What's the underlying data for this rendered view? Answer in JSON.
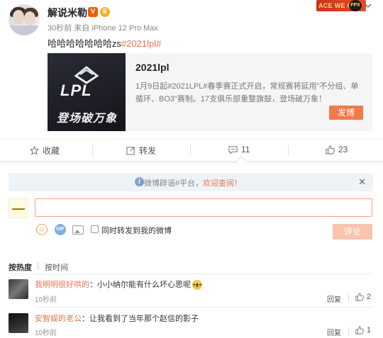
{
  "post": {
    "username": "解说米勒",
    "meta": "30秒前 来自 iPhone 12 Pro Max",
    "text": "哈哈哈哈哈哈哈zs",
    "hashtag": "#2021lpl#",
    "banner_text": "ACE WE CAN",
    "banner_logo": "FPX"
  },
  "card": {
    "logo": "LPL",
    "slogan": "登场破万象",
    "title": "2021lpl",
    "description": "1月9日起#2021LPL#春季赛正式开启，常规赛将延用\"不分组、单循环、BO3\"赛制。17支俱乐部重整旗鼓，登场破万象！",
    "button": "发博"
  },
  "actions": {
    "favorite": "收藏",
    "repost": "转发",
    "comment_count": "11",
    "like_count": "23"
  },
  "comments": {
    "notice_prefix": "#微博辟谣#平台，",
    "notice_highlight": "欢迎查阅！",
    "input_value": "",
    "repost_label": "同时转发到我的微博",
    "submit": "评论",
    "sort_hot": "按热度",
    "sort_time": "按时间",
    "items": [
      {
        "user": "我明明很好哄的",
        "text": "小小纳尔能有什么坏心思呢",
        "time": "10秒前",
        "reply": "回复",
        "likes": "2"
      },
      {
        "user": "安智娱的老公",
        "text": "让我看到了当年那个赵信的影子",
        "time": "10秒前",
        "reply": "回复",
        "likes": "1"
      }
    ]
  },
  "colors": {
    "accent": "#eb7350",
    "button": "#f07a4a"
  }
}
